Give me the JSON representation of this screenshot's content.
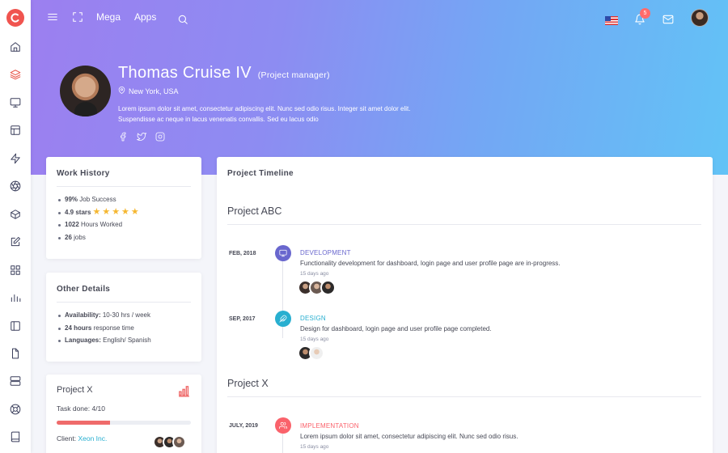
{
  "topnav": {
    "mega": "Mega",
    "apps": "Apps",
    "notification_count": "5"
  },
  "profile": {
    "name": "Thomas Cruise IV",
    "role": "(Project manager)",
    "location": "New York, USA",
    "bio_line1": "Lorem ipsum dolor sit amet, consectetur adipiscing elit. Nunc sed odio risus. Integer sit amet dolor elit.",
    "bio_line2": "Suspendisse ac neque in lacus venenatis convallis. Sed eu lacus odio"
  },
  "work_history": {
    "title": "Work History",
    "job_success_value": "99%",
    "job_success_label": "Job Success",
    "stars_value": "4.9 stars",
    "rating": 5,
    "hours_value": "1022",
    "hours_label": "Hours Worked",
    "jobs_value": "26",
    "jobs_label": "jobs"
  },
  "other_details": {
    "title": "Other Details",
    "availability_label": "Availability:",
    "availability_value": "10-30 hrs / week",
    "response_value": "24 hours",
    "response_label": "response time",
    "languages_label": "Languages:",
    "languages_value": "English/ Spanish"
  },
  "project_x_card": {
    "title": "Project X",
    "task_done": "Task done: 4/10",
    "progress": 0.4,
    "client_label": "Client:",
    "client_value": "Xeon Inc."
  },
  "timeline": {
    "title": "Project Timeline",
    "sections": [
      {
        "name": "Project ABC",
        "items": [
          {
            "date": "FEB, 2018",
            "heading": "DEVELOPMENT",
            "color": "#6967ce",
            "icon": "monitor-icon",
            "description": "Functionality development for dashboard, login page and user profile page are in-progress.",
            "time": "15 days ago"
          },
          {
            "date": "SEP, 2017",
            "heading": "DESIGN",
            "color": "#28afd0",
            "icon": "feather-icon",
            "description": "Design for dashboard, login page and user profile page completed.",
            "time": "15 days ago"
          }
        ]
      },
      {
        "name": "Project X",
        "items": [
          {
            "date": "JULY, 2019",
            "heading": "IMPLEMENTATION",
            "color": "#fa626b",
            "icon": "users-icon",
            "description": "Lorem ipsum dolor sit amet, consectetur adipiscing elit. Nunc sed odio risus.",
            "time": "15 days ago"
          }
        ]
      }
    ]
  }
}
